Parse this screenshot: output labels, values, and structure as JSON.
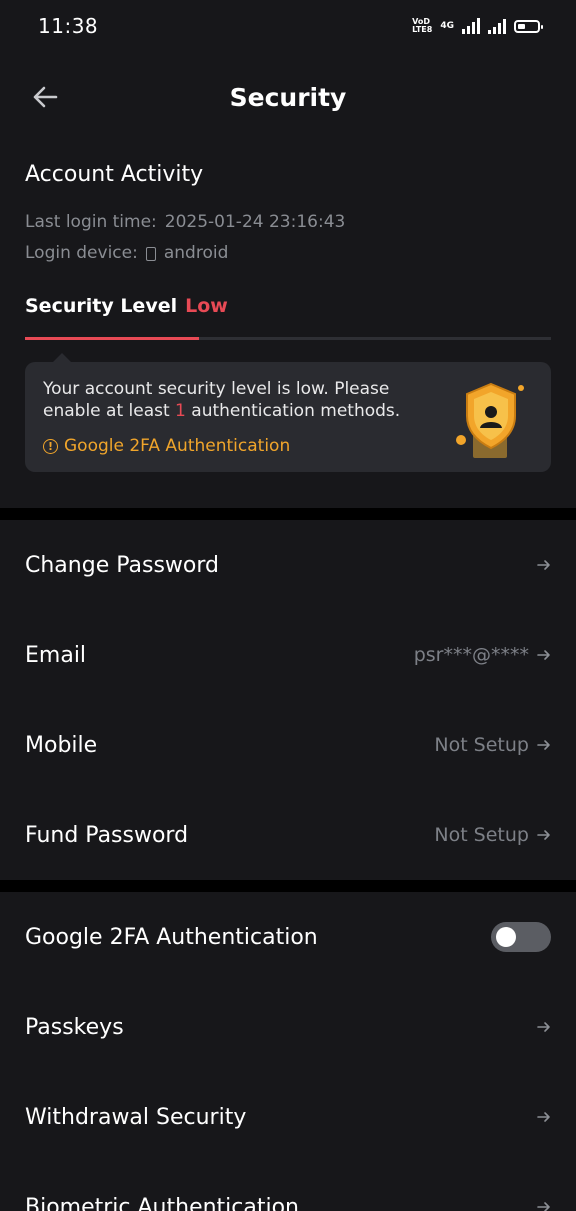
{
  "status_bar": {
    "time": "11:38",
    "vol_top": "VoD",
    "vol_bottom": "LTE8",
    "network": "4G"
  },
  "header": {
    "title": "Security"
  },
  "activity": {
    "title": "Account Activity",
    "last_login_label": "Last login time:",
    "last_login_value": "2025-01-24 23:16:43",
    "device_label": "Login device:",
    "device_value": "android"
  },
  "security_level": {
    "label": "Security Level",
    "value": "Low",
    "progress": 0.33,
    "notice_part1": "Your account security level is low. Please enable at least ",
    "notice_count": "1",
    "notice_part2": " authentication methods.",
    "action_label": "Google 2FA Authentication"
  },
  "settings_group1": [
    {
      "label": "Change Password",
      "value": ""
    },
    {
      "label": "Email",
      "value": "psr***@****"
    },
    {
      "label": "Mobile",
      "value": "Not Setup"
    },
    {
      "label": "Fund Password",
      "value": "Not Setup"
    }
  ],
  "settings_group2": [
    {
      "label": "Google 2FA Authentication",
      "toggle": false
    },
    {
      "label": "Passkeys"
    },
    {
      "label": "Withdrawal Security"
    },
    {
      "label": "Biometric Authentication"
    }
  ],
  "colors": {
    "background": "#17171a",
    "accent_red": "#e84a55",
    "accent_orange": "#f0a52b",
    "muted_text": "#7d8087"
  }
}
